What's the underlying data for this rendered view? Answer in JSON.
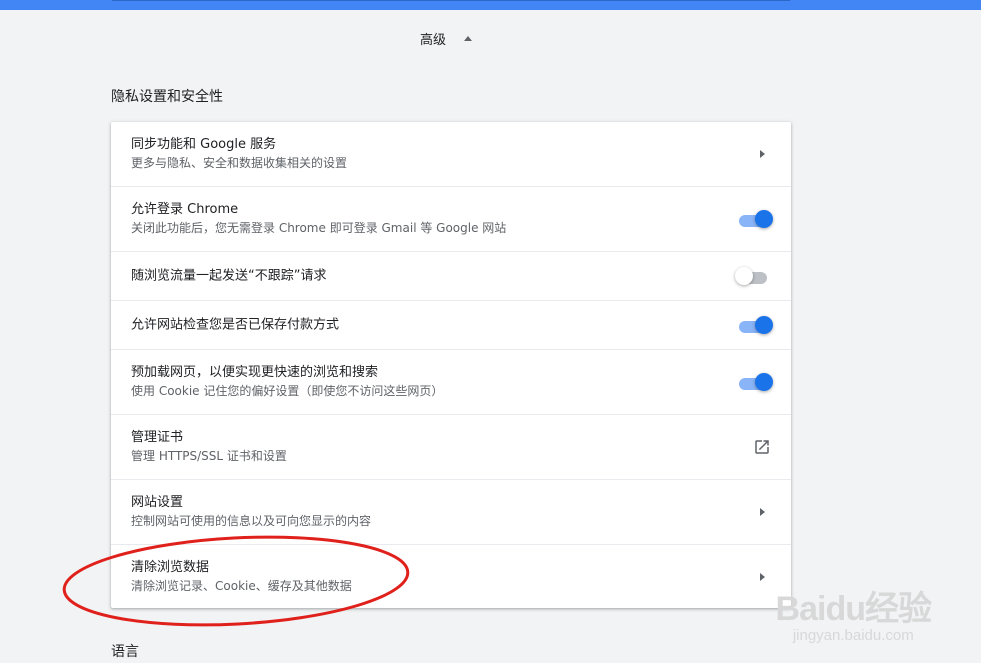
{
  "advanced": {
    "label": "高级"
  },
  "privacy_section": {
    "title": "隐私设置和安全性",
    "rows": [
      {
        "title": "同步功能和 Google 服务",
        "subtitle": "更多与隐私、安全和数据收集相关的设置",
        "control": "arrow"
      },
      {
        "title": "允许登录 Chrome",
        "subtitle": "关闭此功能后，您无需登录 Chrome 即可登录 Gmail 等 Google 网站",
        "control": "toggle",
        "enabled": true
      },
      {
        "title": "随浏览流量一起发送“不跟踪”请求",
        "control": "toggle",
        "enabled": false
      },
      {
        "title": "允许网站检查您是否已保存付款方式",
        "control": "toggle",
        "enabled": true
      },
      {
        "title": "预加载网页，以便实现更快速的浏览和搜索",
        "subtitle": "使用 Cookie 记住您的偏好设置（即使您不访问这些网页）",
        "control": "toggle",
        "enabled": true
      },
      {
        "title": "管理证书",
        "subtitle": "管理 HTTPS/SSL 证书和设置",
        "control": "external-link"
      },
      {
        "title": "网站设置",
        "subtitle": "控制网站可使用的信息以及可向您显示的内容",
        "control": "arrow"
      },
      {
        "title": "清除浏览数据",
        "subtitle": "清除浏览记录、Cookie、缓存及其他数据",
        "control": "arrow"
      }
    ]
  },
  "language_section": {
    "title": "语言"
  },
  "colors": {
    "accent": "#1a73e8",
    "toggle_track_on": "#8ab4f8",
    "annotation": "#e0201b"
  },
  "watermark": {
    "logo": "Baidu经验",
    "url": "jingyan.baidu.com"
  }
}
